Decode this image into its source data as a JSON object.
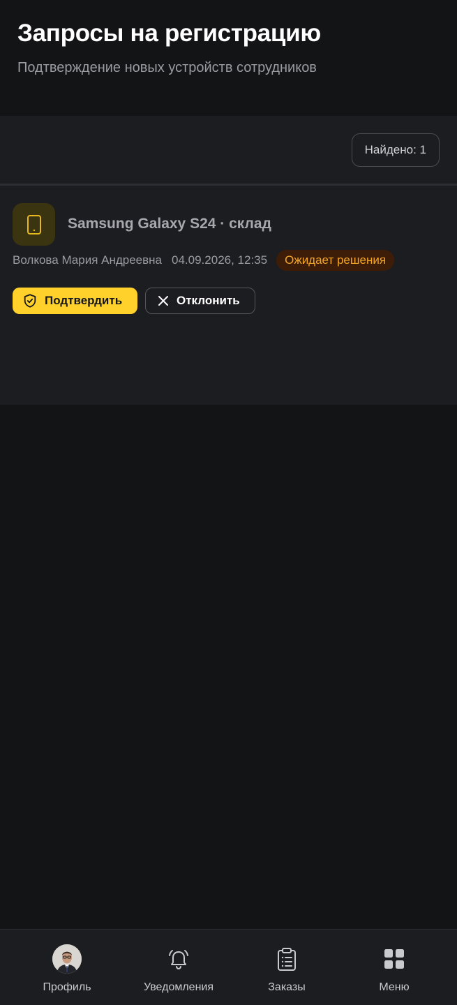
{
  "header": {
    "title": "Запросы на регистрацию",
    "subtitle": "Подтверждение новых устройств сотрудников"
  },
  "toolbar": {
    "found_label": "Найдено: 1"
  },
  "requests": [
    {
      "icon": "smartphone-icon",
      "device": "Samsung Galaxy S24 · склад",
      "employee": "Волкова Мария Андреевна",
      "datetime": "04.09.2026, 12:35",
      "status": "Ожидает решения",
      "confirm_label": "Подтвердить",
      "reject_label": "Отклонить"
    }
  ],
  "nav": {
    "items": [
      {
        "label": "Профиль",
        "icon": "avatar"
      },
      {
        "label": "Уведомления",
        "icon": "bell-icon"
      },
      {
        "label": "Заказы",
        "icon": "clipboard-icon"
      },
      {
        "label": "Меню",
        "icon": "grid-icon"
      }
    ]
  },
  "colors": {
    "accent": "#ffd12a",
    "status_text": "#f5a623",
    "status_bg": "#3d1c08",
    "background": "#131416",
    "surface": "#1c1d21"
  }
}
